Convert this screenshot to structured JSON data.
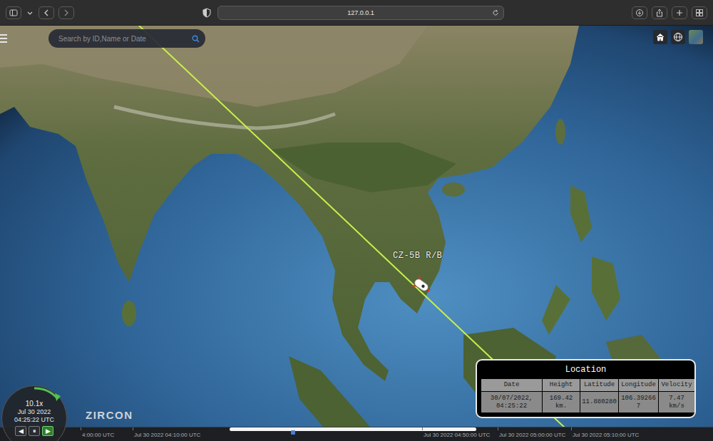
{
  "browser": {
    "address": "127.0.0.1"
  },
  "search": {
    "placeholder": "Search by ID,Name or Date"
  },
  "satellite": {
    "label": "CZ-5B R/B"
  },
  "location_panel": {
    "title": "Location",
    "columns": [
      "Date",
      "Height",
      "Latitude",
      "Longitude",
      "Velocity"
    ],
    "row": [
      "30/07/2022, 04:25:22",
      "169.42 km.",
      "11.880280",
      "106.392667",
      "7.47 km/s"
    ]
  },
  "clock": {
    "speed": "10.1x",
    "date": "Jul 30 2022",
    "time": "04:25:22 UTC"
  },
  "playback_buttons": [
    {
      "label": "◀",
      "selected": false
    },
    {
      "label": "⏸",
      "selected": false
    },
    {
      "label": "▶",
      "selected": true
    }
  ],
  "logo": "ZIRCON",
  "timeline": {
    "ticks": [
      "4:00:00 UTC",
      "Jul 30 2022 04:10:00 UTC",
      "Jul 30 2022 04:50:00 UTC",
      "Jul 30 2022 05:00:00 UTC",
      "Jul 30 2022 05:10:00 UTC"
    ]
  }
}
